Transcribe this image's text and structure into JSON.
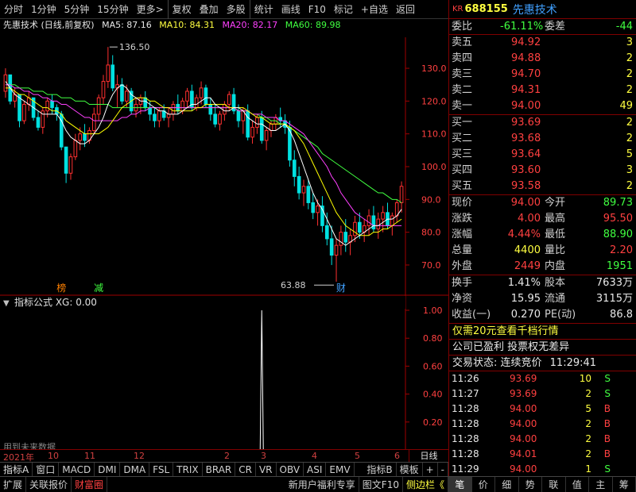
{
  "toolbar": {
    "items": [
      "分时",
      "1分钟",
      "5分钟",
      "15分钟",
      "更多>",
      "复权",
      "叠加",
      "多股",
      "统计",
      "画线",
      "F10",
      "标记",
      "+自选",
      "返回"
    ]
  },
  "legend": {
    "title": "先惠技术 (日线,前复权)",
    "ma5": "MA5: 87.16",
    "ma10": "MA10: 84.31",
    "ma20": "MA20: 82.17",
    "ma60": "MA60: 89.98"
  },
  "chart_data": {
    "type": "candlestick",
    "price_axis": [
      "130.0",
      "120.0",
      "110.0",
      "100.0",
      "90.0",
      "80.0",
      "70.0"
    ],
    "ylim": [
      62,
      138
    ],
    "high_label": "136.50",
    "low_label": "63.88",
    "markers": {
      "bang": "榜",
      "jian": "减",
      "cai": "财"
    },
    "candles": [
      [
        123,
        130,
        121,
        128
      ],
      [
        128,
        126,
        119,
        120
      ],
      [
        120,
        124,
        118,
        122
      ],
      [
        122,
        118,
        112,
        114
      ],
      [
        114,
        120,
        113,
        119
      ],
      [
        119,
        123,
        117,
        121
      ],
      [
        121,
        118,
        114,
        115
      ],
      [
        115,
        117,
        111,
        112
      ],
      [
        112,
        118,
        110,
        117
      ],
      [
        117,
        121,
        115,
        120
      ],
      [
        120,
        122,
        116,
        118
      ],
      [
        118,
        119,
        114,
        116
      ],
      [
        116,
        117,
        105,
        106
      ],
      [
        106,
        106,
        95,
        98
      ],
      [
        98,
        104,
        96,
        103
      ],
      [
        103,
        110,
        102,
        108
      ],
      [
        108,
        112,
        105,
        110
      ],
      [
        110,
        113,
        106,
        108
      ],
      [
        108,
        112,
        107,
        111
      ],
      [
        111,
        118,
        110,
        116
      ],
      [
        116,
        122,
        114,
        121
      ],
      [
        121,
        128,
        119,
        126
      ],
      [
        126,
        136.5,
        124,
        131
      ],
      [
        131,
        134,
        123,
        124
      ],
      [
        124,
        128,
        118,
        125
      ],
      [
        125,
        127,
        119,
        120
      ],
      [
        120,
        125,
        118,
        123
      ],
      [
        123,
        124,
        116,
        117
      ],
      [
        117,
        121,
        115,
        119
      ],
      [
        119,
        122,
        116,
        121
      ],
      [
        121,
        123,
        117,
        118
      ],
      [
        118,
        120,
        114,
        116
      ],
      [
        116,
        118,
        112,
        114
      ],
      [
        114,
        118,
        112,
        117
      ],
      [
        117,
        119,
        114,
        115
      ],
      [
        115,
        118,
        112,
        116
      ],
      [
        116,
        120,
        114,
        119
      ],
      [
        119,
        122,
        116,
        117
      ],
      [
        117,
        121,
        116,
        120
      ],
      [
        120,
        124,
        118,
        123
      ],
      [
        123,
        125,
        117,
        118
      ],
      [
        118,
        122,
        117,
        121
      ],
      [
        121,
        126,
        119,
        124
      ],
      [
        124,
        125,
        118,
        119
      ],
      [
        119,
        121,
        114,
        116
      ],
      [
        116,
        119,
        112,
        113
      ],
      [
        113,
        117,
        111,
        116
      ],
      [
        116,
        120,
        114,
        119
      ],
      [
        119,
        123,
        117,
        122
      ],
      [
        122,
        124,
        116,
        117
      ],
      [
        117,
        119,
        112,
        114
      ],
      [
        114,
        118,
        110,
        117
      ],
      [
        117,
        119,
        108,
        109
      ],
      [
        109,
        114,
        107,
        112
      ],
      [
        112,
        116,
        110,
        115
      ],
      [
        115,
        117,
        107,
        108
      ],
      [
        108,
        112,
        105,
        111
      ],
      [
        111,
        114,
        109,
        113
      ],
      [
        113,
        116,
        111,
        115
      ],
      [
        115,
        118,
        112,
        114
      ],
      [
        114,
        116,
        110,
        112
      ],
      [
        112,
        114,
        100,
        102
      ],
      [
        102,
        105,
        94,
        97
      ],
      [
        97,
        100,
        90,
        92
      ],
      [
        92,
        96,
        88,
        94
      ],
      [
        94,
        96,
        87,
        89
      ],
      [
        89,
        92,
        84,
        86
      ],
      [
        86,
        90,
        82,
        88
      ],
      [
        88,
        91,
        80,
        82
      ],
      [
        82,
        86,
        76,
        78
      ],
      [
        78,
        82,
        70,
        73
      ],
      [
        73,
        78,
        63.88,
        76
      ],
      [
        76,
        82,
        73,
        80
      ],
      [
        80,
        84,
        74,
        77
      ],
      [
        77,
        81,
        73,
        79
      ],
      [
        79,
        85,
        77,
        83
      ],
      [
        83,
        86,
        78,
        80
      ],
      [
        80,
        84,
        77,
        82
      ],
      [
        82,
        87,
        79,
        85
      ],
      [
        85,
        88,
        80,
        81
      ],
      [
        81,
        86,
        78,
        84
      ],
      [
        84,
        88,
        80,
        86
      ],
      [
        86,
        89,
        81,
        82
      ],
      [
        82,
        86,
        79,
        85
      ],
      [
        85,
        90,
        83,
        89
      ],
      [
        89,
        95.5,
        86,
        94
      ]
    ],
    "ma5": [
      126,
      124,
      122,
      121,
      120,
      119,
      118,
      117,
      116,
      116,
      116,
      116,
      114,
      111,
      109,
      108,
      107,
      107,
      108,
      110,
      112,
      115,
      119,
      122,
      124,
      125,
      124,
      122,
      121,
      120,
      120,
      119,
      118,
      117,
      117,
      116,
      116,
      116,
      117,
      118,
      119,
      119,
      120,
      121,
      121,
      119,
      118,
      117,
      117,
      118,
      118,
      117,
      115,
      114,
      113,
      113,
      112,
      111,
      111,
      112,
      113,
      111,
      108,
      104,
      100,
      96,
      92,
      89,
      87,
      84,
      81,
      78,
      77,
      76,
      77,
      78,
      79,
      80,
      81,
      82,
      82,
      83,
      84,
      84,
      85,
      87
    ],
    "ma10": [
      124,
      124,
      123,
      122,
      122,
      121,
      120,
      119,
      118,
      118,
      117,
      117,
      116,
      114,
      113,
      112,
      111,
      110,
      110,
      110,
      110,
      111,
      112,
      114,
      116,
      118,
      119,
      120,
      121,
      121,
      121,
      120,
      120,
      119,
      118,
      118,
      117,
      117,
      117,
      117,
      117,
      118,
      118,
      119,
      119,
      119,
      119,
      119,
      118,
      118,
      118,
      118,
      117,
      116,
      115,
      115,
      114,
      113,
      113,
      113,
      113,
      112,
      111,
      109,
      107,
      104,
      101,
      98,
      95,
      92,
      89,
      86,
      84,
      82,
      81,
      80,
      79,
      79,
      79,
      80,
      80,
      81,
      81,
      82,
      83,
      84
    ],
    "ma20": [
      125,
      125,
      124,
      124,
      123,
      123,
      122,
      122,
      121,
      121,
      120,
      120,
      119,
      119,
      118,
      117,
      116,
      115,
      115,
      114,
      114,
      114,
      114,
      114,
      114,
      115,
      115,
      116,
      116,
      117,
      117,
      118,
      118,
      118,
      118,
      118,
      118,
      118,
      118,
      118,
      118,
      118,
      118,
      118,
      118,
      118,
      118,
      118,
      118,
      118,
      117,
      117,
      117,
      116,
      116,
      116,
      115,
      115,
      115,
      114,
      114,
      113,
      112,
      111,
      110,
      108,
      106,
      104,
      102,
      100,
      97,
      95,
      92,
      90,
      88,
      86,
      85,
      84,
      83,
      82,
      82,
      82,
      82,
      82,
      82,
      82
    ],
    "ma60": [
      125,
      125,
      125,
      124,
      124,
      124,
      123,
      123,
      123,
      122,
      122,
      122,
      121,
      121,
      121,
      120,
      120,
      120,
      119,
      119,
      119,
      119,
      119,
      118,
      118,
      118,
      118,
      118,
      118,
      118,
      118,
      118,
      118,
      118,
      118,
      118,
      118,
      118,
      118,
      118,
      118,
      118,
      118,
      118,
      118,
      118,
      118,
      118,
      118,
      118,
      117,
      117,
      117,
      116,
      116,
      115,
      115,
      114,
      114,
      113,
      113,
      112,
      111,
      110,
      109,
      108,
      107,
      106,
      104,
      103,
      102,
      101,
      100,
      99,
      98,
      97,
      96,
      95,
      94,
      93,
      92,
      92,
      91,
      90,
      90,
      89
    ]
  },
  "indicator": {
    "title": "指标公式 XG: 0.00",
    "axis": [
      "1.00",
      "0.80",
      "0.60",
      "0.40",
      "0.20"
    ],
    "future_note": "用到未来数据",
    "spike_index": 55
  },
  "date_axis": {
    "labels": [
      "2021年",
      "10",
      "11",
      "12",
      "2",
      "3",
      "4",
      "5",
      "6"
    ],
    "day_label": "日线"
  },
  "indicator_tabs": [
    "指标A",
    "窗口",
    "MACD",
    "DMI",
    "DMA",
    "FSL",
    "TRIX",
    "BRAR",
    "CR",
    "VR",
    "OBV",
    "ASI",
    "EMV",
    "指标B",
    "模板",
    "+",
    "-"
  ],
  "bottom_bar": {
    "left": [
      "扩展",
      "关联报价",
      "财富圈"
    ],
    "right": [
      "新用户福利专享",
      "图文F10",
      "侧边栏《"
    ]
  },
  "quote": {
    "kr": "KR",
    "code": "688155",
    "name": "先惠技术",
    "weibi_label": "委比",
    "weibi_value": "-61.11%",
    "weicha_label": "委差",
    "weicha_value": "-44",
    "asks": [
      {
        "label": "卖五",
        "price": "94.92",
        "vol": "3"
      },
      {
        "label": "卖四",
        "price": "94.88",
        "vol": "2"
      },
      {
        "label": "卖三",
        "price": "94.70",
        "vol": "2"
      },
      {
        "label": "卖二",
        "price": "94.31",
        "vol": "2"
      },
      {
        "label": "卖一",
        "price": "94.00",
        "vol": "49"
      }
    ],
    "bids": [
      {
        "label": "买一",
        "price": "93.69",
        "vol": "2"
      },
      {
        "label": "买二",
        "price": "93.68",
        "vol": "2"
      },
      {
        "label": "买三",
        "price": "93.64",
        "vol": "5"
      },
      {
        "label": "买四",
        "price": "93.60",
        "vol": "3"
      },
      {
        "label": "买五",
        "price": "93.58",
        "vol": "2"
      }
    ],
    "stats": [
      {
        "l1": "现价",
        "v1": "94.00",
        "c1": "red",
        "l2": "今开",
        "v2": "89.73",
        "c2": "green"
      },
      {
        "l1": "涨跌",
        "v1": "4.00",
        "c1": "red",
        "l2": "最高",
        "v2": "95.50",
        "c2": "red"
      },
      {
        "l1": "涨幅",
        "v1": "4.44%",
        "c1": "red",
        "l2": "最低",
        "v2": "88.90",
        "c2": "green"
      },
      {
        "l1": "总量",
        "v1": "4400",
        "c1": "yellow",
        "l2": "量比",
        "v2": "2.20",
        "c2": "red"
      },
      {
        "l1": "外盘",
        "v1": "2449",
        "c1": "red",
        "l2": "内盘",
        "v2": "1951",
        "c2": "green"
      }
    ],
    "fund": [
      {
        "l1": "换手",
        "v1": "1.41%",
        "l2": "股本",
        "v2": "7633万"
      },
      {
        "l1": "净资",
        "v1": "15.95",
        "l2": "流通",
        "v2": "3115万"
      },
      {
        "l1": "收益(一)",
        "v1": "0.270",
        "l2": "PE(动)",
        "v2": "86.8"
      }
    ],
    "promo1": "仅需20元查看千档行情",
    "promo2": "公司已盈利 投票权无差异",
    "status_label": "交易状态: 连续竞价",
    "status_time": "11:29:41",
    "ticks": [
      {
        "t": "11:26",
        "p": "93.69",
        "v": "10",
        "s": "S"
      },
      {
        "t": "11:27",
        "p": "93.69",
        "v": "2",
        "s": "S"
      },
      {
        "t": "11:28",
        "p": "94.00",
        "v": "5",
        "s": "B"
      },
      {
        "t": "11:28",
        "p": "94.00",
        "v": "2",
        "s": "B"
      },
      {
        "t": "11:28",
        "p": "94.00",
        "v": "2",
        "s": "B"
      },
      {
        "t": "11:28",
        "p": "94.01",
        "v": "2",
        "s": "B"
      },
      {
        "t": "11:29",
        "p": "94.00",
        "v": "1",
        "s": "S"
      }
    ]
  },
  "right_tabs": [
    "笔",
    "价",
    "细",
    "势",
    "联",
    "值",
    "主",
    "筹"
  ],
  "colors": {
    "up": "#ff3030",
    "down": "#00e0e0",
    "ma5": "#ffffff",
    "ma10": "#ffff00",
    "ma20": "#ff40ff",
    "ma60": "#40ff40"
  }
}
